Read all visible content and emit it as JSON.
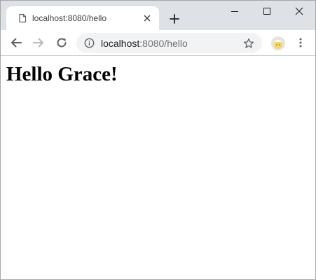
{
  "tab": {
    "title": "localhost:8080/hello",
    "favicon": "document-icon"
  },
  "window_controls": {
    "minimize_icon": "minimize-icon",
    "maximize_icon": "maximize-icon",
    "close_icon": "close-icon"
  },
  "toolbar": {
    "back_icon": "arrow-left-icon",
    "forward_icon": "arrow-right-icon",
    "reload_icon": "reload-icon",
    "url_host": "localhost",
    "url_rest": ":8080/hello",
    "site_info_icon": "info-icon",
    "bookmark_icon": "star-icon",
    "profile_icon": "avatar",
    "menu_icon": "kebab-menu-icon"
  },
  "page": {
    "heading": "Hello Grace!"
  },
  "colors": {
    "tabstrip": "#dee1e6",
    "omnibox": "#f1f3f4",
    "url_host": "#202124",
    "url_rest": "#70757a",
    "icon": "#5f6368"
  }
}
